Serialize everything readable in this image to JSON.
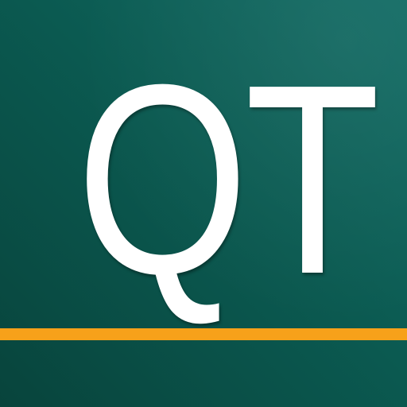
{
  "logo": {
    "text": "QT",
    "text_color": "#ffffff"
  },
  "colors": {
    "background_light": "#116b64",
    "background_dark": "#08443c",
    "accent_line": "#f7a11a"
  }
}
